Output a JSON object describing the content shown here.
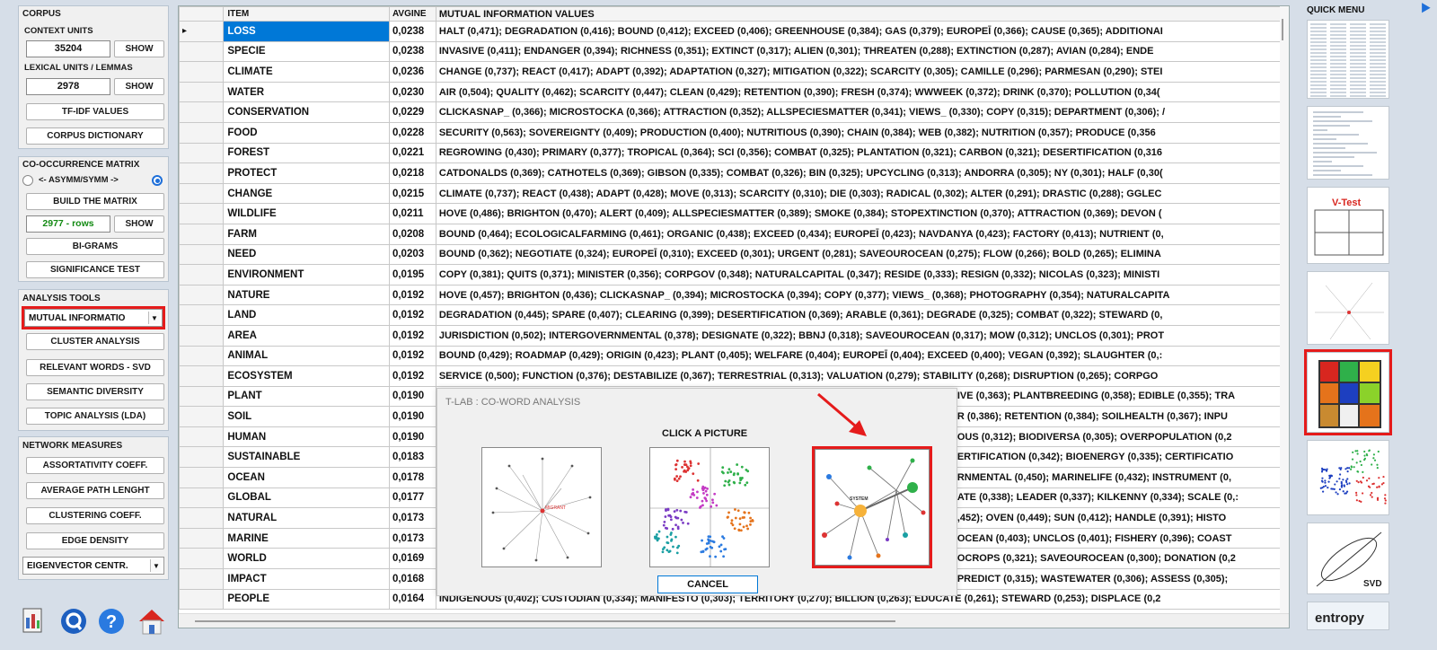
{
  "corpus": {
    "title": "CORPUS",
    "context_units_label": "CONTEXT UNITS",
    "context_units_value": "35204",
    "show_label": "SHOW",
    "lexical_units_label": "LEXICAL UNITS / LEMMAS",
    "lexical_units_value": "2978",
    "tfidf_label": "TF-IDF VALUES",
    "dictionary_label": "CORPUS DICTIONARY"
  },
  "cooccurrence": {
    "title": "CO-OCCURRENCE MATRIX",
    "asym_label": "<- ASYMM/SYMM ->",
    "build_label": "BUILD THE MATRIX",
    "rows_value": "2977 - rows",
    "show_label": "SHOW",
    "bigrams_label": "BI-GRAMS",
    "significance_label": "SIGNIFICANCE TEST"
  },
  "analysis_tools": {
    "title": "ANALYSIS TOOLS",
    "selected_tool": "MUTUAL INFORMATIO",
    "cluster_label": "CLUSTER ANALYSIS",
    "svd_label": "RELEVANT WORDS - SVD",
    "diversity_label": "SEMANTIC DIVERSITY",
    "lda_label": "TOPIC ANALYSIS (LDA)"
  },
  "network": {
    "title": "NETWORK MEASURES",
    "assort_label": "ASSORTATIVITY COEFF.",
    "path_label": "AVERAGE PATH LENGHT",
    "clustering_label": "CLUSTERING COEFF.",
    "density_label": "EDGE DENSITY",
    "eigen_selected": "EIGENVECTOR CENTR."
  },
  "table": {
    "headers": {
      "item": "ITEM",
      "avg": "AVGINE",
      "mi": "MUTUAL INFORMATION VALUES"
    },
    "rows": [
      {
        "item": "LOSS",
        "avg": "0,0238",
        "mi": "HALT (0,471); DEGRADATION (0,416); BOUND (0,412); EXCEED (0,406); GREENHOUSE (0,384); GAS (0,379); EUROPEĪ (0,366); CAUSE (0,365); ADDITIONAI"
      },
      {
        "item": "SPECIE",
        "avg": "0,0238",
        "mi": "INVASIVE (0,411); ENDANGER (0,394); RICHNESS (0,351); EXTINCT (0,317); ALIEN (0,301); THREATEN (0,288); EXTINCTION (0,287); AVIAN (0,284); ENDE"
      },
      {
        "item": "CLIMATE",
        "avg": "0,0236",
        "mi": "CHANGE (0,737); REACT (0,417); ADAPT (0,392); ADAPTATION (0,327); MITIGATION (0,322); SCARCITY (0,305); CAMILLE (0,296); PARMESAN (0,290); STEI"
      },
      {
        "item": "WATER",
        "avg": "0,0230",
        "mi": "AIR (0,504); QUALITY (0,462); SCARCITY (0,447); CLEAN (0,429); RETENTION (0,390); FRESH (0,374); WWWEEK (0,372); DRINK (0,370); POLLUTION (0,34("
      },
      {
        "item": "CONSERVATION",
        "avg": "0,0229",
        "mi": "CLICKASNAP_ (0,366); MICROSTOCKA (0,366); ATTRACTION (0,352); ALLSPECIESMATTER (0,341); VIEWS_ (0,330); COPY (0,315); DEPARTMENT (0,306); /"
      },
      {
        "item": "FOOD",
        "avg": "0,0228",
        "mi": "SECURITY (0,563); SOVEREIGNTY (0,409); PRODUCTION (0,400); NUTRITIOUS (0,390); CHAIN (0,384); WEB (0,382); NUTRITION (0,357); PRODUCE (0,356"
      },
      {
        "item": "FOREST",
        "avg": "0,0221",
        "mi": "REGROWING (0,430); PRIMARY (0,377); TROPICAL (0,364); SCI (0,356); COMBAT (0,325); PLANTATION (0,321); CARBON (0,321); DESERTIFICATION (0,316"
      },
      {
        "item": "PROTECT",
        "avg": "0,0218",
        "mi": "CATDONALDS (0,369); CATHOTELS (0,369); GIBSON (0,335); COMBAT (0,326); BIN (0,325); UPCYCLING (0,313); ANDORRA (0,305); NY (0,301); HALF (0,30("
      },
      {
        "item": "CHANGE",
        "avg": "0,0215",
        "mi": "CLIMATE (0,737); REACT (0,438); ADAPT (0,428); MOVE (0,313); SCARCITY (0,310); DIE (0,303); RADICAL (0,302); ALTER (0,291); DRASTIC (0,288); GGLEC"
      },
      {
        "item": "WILDLIFE",
        "avg": "0,0211",
        "mi": "HOVE (0,486); BRIGHTON (0,470); ALERT (0,409); ALLSPECIESMATTER (0,389); SMOKE (0,384); STOPEXTINCTION (0,370); ATTRACTION (0,369); DEVON ("
      },
      {
        "item": "FARM",
        "avg": "0,0208",
        "mi": "BOUND (0,464); ECOLOGICALFARMING (0,461); ORGANIC (0,438); EXCEED (0,434); EUROPEĪ (0,423); NAVDANYA (0,423); FACTORY (0,413); NUTRIENT (0,"
      },
      {
        "item": "NEED",
        "avg": "0,0203",
        "mi": "BOUND (0,362); NEGOTIATE (0,324); EUROPEĪ (0,310); EXCEED (0,301); URGENT (0,281); SAVEOUROCEAN (0,275); FLOW (0,266); BOLD (0,265); ELIMINA"
      },
      {
        "item": "ENVIRONMENT",
        "avg": "0,0195",
        "mi": "COPY (0,381); QUITS (0,371); MINISTER (0,356); CORPGOV (0,348); NATURALCAPITAL (0,347); RESIDE (0,333); RESIGN (0,332); NICOLAS (0,323); MINISTI"
      },
      {
        "item": "NATURE",
        "avg": "0,0192",
        "mi": "HOVE (0,457); BRIGHTON (0,436); CLICKASNAP_ (0,394); MICROSTOCKA (0,394); COPY (0,377); VIEWS_ (0,368); PHOTOGRAPHY (0,354); NATURALCAPITA"
      },
      {
        "item": "LAND",
        "avg": "0,0192",
        "mi": "DEGRADATION (0,445); SPARE (0,407); CLEARING (0,399); DESERTIFICATION (0,369); ARABLE (0,361); DEGRADE (0,325); COMBAT (0,322); STEWARD (0,"
      },
      {
        "item": "AREA",
        "avg": "0,0192",
        "mi": "JURISDICTION (0,502); INTERGOVERNMENTAL (0,378); DESIGNATE (0,322); BBNJ (0,318); SAVEOUROCEAN (0,317); MOW (0,312); UNCLOS (0,301); PROT"
      },
      {
        "item": "ANIMAL",
        "avg": "0,0192",
        "mi": "BOUND (0,429); ROADMAP (0,429); ORIGIN (0,423); PLANT (0,405); WELFARE (0,404); EUROPEĪ (0,404); EXCEED (0,400); VEGAN (0,392); SLAUGHTER (0,:"
      },
      {
        "item": "ECOSYSTEM",
        "avg": "0,0192",
        "mi": "SERVICE (0,500); FUNCTION (0,376); DESTABILIZE (0,367); TERRESTRIAL (0,313); VALUATION (0,279); STABILITY (0,268); DISRUPTION (0,265); CORPGO"
      },
      {
        "item": "PLANT",
        "avg": "0,0190",
        "mi": "IVE (0,363); PLANTBREEDING (0,358); EDIBLE (0,355); TRA"
      },
      {
        "item": "SOIL",
        "avg": "0,0190",
        "mi": "R (0,386); RETENTION (0,384); SOILHEALTH (0,367); INPU"
      },
      {
        "item": "HUMAN",
        "avg": "0,0190",
        "mi": "OUS (0,312); BIODIVERSA (0,305); OVERPOPULATION (0,2"
      },
      {
        "item": "SUSTAINABLE",
        "avg": "0,0183",
        "mi": "ERTIFICATION (0,342); BIOENERGY (0,335); CERTIFICATIO"
      },
      {
        "item": "OCEAN",
        "avg": "0,0178",
        "mi": "RNMENTAL (0,450); MARINELIFE (0,432); INSTRUMENT (0,"
      },
      {
        "item": "GLOBAL",
        "avg": "0,0177",
        "mi": "ATE (0,338); LEADER (0,337); KILKENNY (0,334); SCALE (0,:"
      },
      {
        "item": "NATURAL",
        "avg": "0,0173",
        "mi": ",452); OVEN (0,449); SUN (0,412); HANDLE (0,391); HISTO"
      },
      {
        "item": "MARINE",
        "avg": "0,0173",
        "mi": "OCEAN (0,403); UNCLOS (0,401); FISHERY (0,396); COAST"
      },
      {
        "item": "WORLD",
        "avg": "0,0169",
        "mi": "OCROPS (0,321); SAVEOUROCEAN (0,300); DONATION (0,2"
      },
      {
        "item": "IMPACT",
        "avg": "0,0168",
        "mi": "PREDICT (0,315); WASTEWATER (0,306); ASSESS (0,305);"
      },
      {
        "item": "PEOPLE",
        "avg": "0,0164",
        "mi": "INDIGENOUS (0,402); CUSTODIAN (0,334); MANIFESTO (0,303); TERRITORY (0,270); BILLION (0,263); EDUCATE (0,261); STEWARD (0,253); DISPLACE (0,2"
      }
    ]
  },
  "dialog": {
    "title": "T-LAB : CO-WORD ANALYSIS",
    "subtitle": "CLICK A PICTURE",
    "cancel_label": "CANCEL",
    "node_label": "SYSTEM",
    "radial_center_label": "MIGRANT"
  },
  "quick_menu": {
    "title": "QUICK MENU",
    "arrow": "⯈",
    "vtest_label": "V-Test",
    "svd_label": "SVD",
    "entropy_label": "entropy"
  },
  "colors": {
    "accent": "#0078d7",
    "highlight": "#e51b1b",
    "bg": "#d6dee8"
  }
}
